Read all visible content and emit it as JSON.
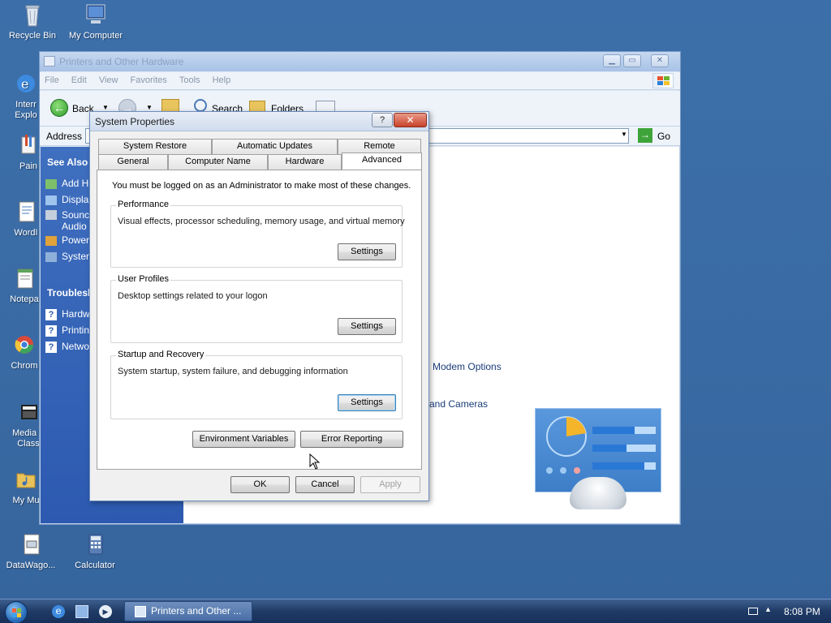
{
  "desktop": {
    "icons": [
      {
        "label": "Recycle Bin",
        "icon": "recycle-bin-icon"
      },
      {
        "label": "My Computer",
        "icon": "my-computer-icon"
      },
      {
        "label": "Interr",
        "label2": "Explo",
        "icon": "internet-explorer-icon"
      },
      {
        "label": "Pain",
        "icon": "paint-icon"
      },
      {
        "label": "WordI",
        "icon": "wordpad-icon"
      },
      {
        "label": "Notepa",
        "icon": "notepad-icon"
      },
      {
        "label": "Chrom",
        "icon": "chrome-icon"
      },
      {
        "label": "Media F",
        "label2": "Class",
        "icon": "media-player-icon"
      },
      {
        "label": "My Mu",
        "icon": "my-music-folder-icon"
      },
      {
        "label": "DataWago...",
        "icon": "datawago-icon"
      },
      {
        "label": "Calculator",
        "icon": "calculator-icon"
      }
    ]
  },
  "explorer": {
    "title": "Printers and Other Hardware",
    "menu": [
      "File",
      "Edit",
      "View",
      "Favorites",
      "Tools",
      "Help"
    ],
    "toolbar": {
      "back": "Back",
      "search": "Search",
      "folders": "Folders"
    },
    "address_label": "Address",
    "go_label": "Go",
    "sidebar": {
      "see_also_title": "See Also",
      "see_also": [
        "Add H",
        "Displa",
        "Sounc",
        "Audio",
        "Power",
        "System"
      ],
      "troubleshoot_title": "Troublesh",
      "troubleshoot": [
        "Hardw",
        "Printin",
        "Netwo"
      ]
    },
    "content": {
      "links": [
        "d Modem Options",
        "and Cameras"
      ]
    }
  },
  "dialog": {
    "title": "System Properties",
    "help_glyph": "?",
    "close_glyph": "✕",
    "tabs_row1": [
      "System Restore",
      "Automatic Updates",
      "Remote"
    ],
    "tabs_row2": [
      "General",
      "Computer Name",
      "Hardware",
      "Advanced"
    ],
    "active_tab": "Advanced",
    "admin_note": "You must be logged on as an Administrator to make most of these changes.",
    "performance": {
      "title": "Performance",
      "desc": "Visual effects, processor scheduling, memory usage, and virtual memory",
      "button": "Settings"
    },
    "user_profiles": {
      "title": "User Profiles",
      "desc": "Desktop settings related to your logon",
      "button": "Settings"
    },
    "startup_recovery": {
      "title": "Startup and Recovery",
      "desc": "System startup, system failure, and debugging information",
      "button": "Settings"
    },
    "env_vars": "Environment Variables",
    "error_reporting": "Error Reporting",
    "ok": "OK",
    "cancel": "Cancel",
    "apply": "Apply"
  },
  "taskbar": {
    "task_label": "Printers and Other ...",
    "clock": "8:08 PM"
  },
  "colors": {
    "desktop": "#3a6ea5",
    "sidebar": "#2d5ab0",
    "accent_blue": "#3c7fb1"
  }
}
